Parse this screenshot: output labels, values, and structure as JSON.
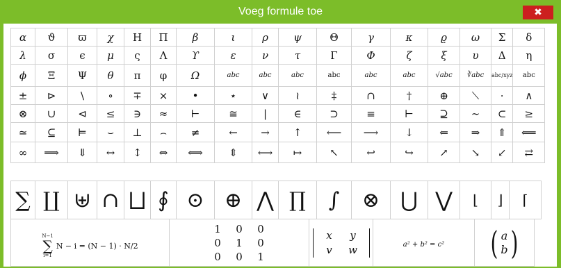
{
  "dialog": {
    "title": "Voeg formule toe",
    "close_label": "✖"
  },
  "symbols": {
    "row1": [
      "α",
      "ϑ",
      "ϖ",
      "χ",
      "H",
      "Π",
      "β",
      "ι",
      "ρ",
      "ψ",
      "Θ",
      "γ",
      "κ",
      "ϱ",
      "ω",
      "Σ",
      "δ"
    ],
    "row2": [
      "λ",
      "σ",
      "ϵ",
      "μ",
      "ς",
      "Λ",
      "ϒ",
      "ε",
      "ν",
      "τ",
      "Γ",
      "Φ",
      "ζ",
      "ξ",
      "υ",
      "Δ",
      "η"
    ],
    "row3": [
      "ϕ",
      "Ξ",
      "Ψ",
      "θ",
      "π",
      "φ",
      "Ω",
      "abc",
      "abc",
      "abc",
      "abc",
      "abc",
      "abc",
      "√abc",
      "∛abc",
      "abc/xyz",
      "abc"
    ],
    "row4": [
      "±",
      "⊳",
      "\\",
      "∘",
      "∓",
      "×",
      "•",
      "⋆",
      "∨",
      "≀",
      "‡",
      "∩",
      "†",
      "⊕",
      "⟍",
      "·",
      "∧"
    ],
    "row5": [
      "⊗",
      "∪",
      "⊲",
      "≤",
      "∋",
      "≈",
      "⊢",
      "≅",
      "|",
      "∈",
      "⊃",
      "≡",
      "⊢",
      "⊇",
      "∼",
      "⊂",
      "≥"
    ],
    "row6": [
      "≃",
      "⊆",
      "⊨",
      "⌣",
      "⊥",
      "⌢",
      "≠",
      "←",
      "→",
      "↑",
      "⟵",
      "⟶",
      "↓",
      "⇐",
      "⇒",
      "⇑",
      "⟸"
    ],
    "row7": [
      "∞",
      "⟹",
      "⇓",
      "↔",
      "↕",
      "⇔",
      "⟺",
      "⇕",
      "⟷",
      "↦",
      "↖",
      "↩",
      "↪",
      "↗",
      "↘",
      "↙",
      "⇄"
    ],
    "big": [
      "∑",
      "∐",
      "⊎",
      "∩",
      "⨆",
      "∮",
      "⊙",
      "⊕",
      "⋀",
      "∏",
      "∫",
      "⊗",
      "⋃",
      "⋁",
      "⌊",
      "⌋",
      "⌈"
    ]
  },
  "formulas": {
    "sum": {
      "upper": "N−1",
      "lower": "i=1",
      "expr": "N − i = (N − 1) · N/2"
    },
    "matrix": [
      [
        "1",
        "0",
        "0"
      ],
      [
        "0",
        "1",
        "0"
      ],
      [
        "0",
        "0",
        "1"
      ]
    ],
    "determinant": [
      [
        "x",
        "y"
      ],
      [
        "v",
        "w"
      ]
    ],
    "pythagoras": "a² + b² = c²",
    "vector": [
      "a",
      "b"
    ]
  }
}
